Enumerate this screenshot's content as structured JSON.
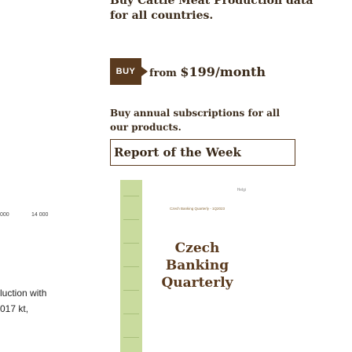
{
  "promo": {
    "title_line1": "Buy Cattle Meat Production data",
    "title_line2": "for all countries.",
    "buy_label": "BUY",
    "price_prefix": "from ",
    "price_amount": "$199/month",
    "annual_line1": "Buy annual subscriptions for all",
    "annual_line2": "our products."
  },
  "report": {
    "title": "Report of the Week",
    "cover_caption": "Czech Banking Quarterly - 1Q2023",
    "cover_heading_1": "Czech",
    "cover_heading_2": "Banking",
    "cover_heading_3": "Quarterly",
    "cover_logo": "Helgi"
  },
  "background_chart": {
    "tick_1": "000",
    "tick_2": "14 000",
    "text_line1": "luction with",
    "text_line2": "017 kt,"
  }
}
